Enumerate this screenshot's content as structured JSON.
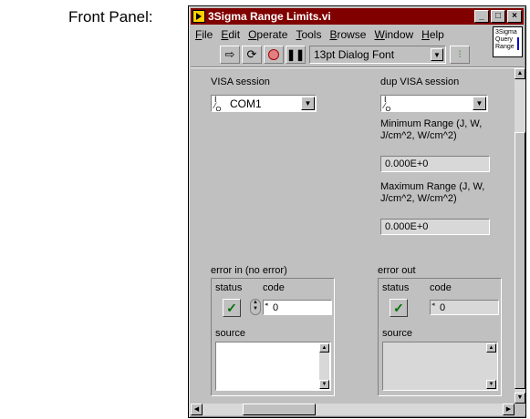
{
  "page": {
    "label": "Front Panel:"
  },
  "window": {
    "title": "3Sigma Range Limits.vi",
    "buttons": [
      "_",
      "□",
      "×"
    ],
    "menu": [
      {
        "label": "File",
        "key": "F",
        "rest": "ile"
      },
      {
        "label": "Edit",
        "key": "E",
        "rest": "dit"
      },
      {
        "label": "Operate",
        "key": "O",
        "rest": "perate"
      },
      {
        "label": "Tools",
        "key": "T",
        "rest": "ools"
      },
      {
        "label": "Browse",
        "key": "B",
        "rest": "rowse"
      },
      {
        "label": "Window",
        "key": "W",
        "rest": "indow"
      },
      {
        "label": "Help",
        "key": "H",
        "rest": "elp"
      }
    ],
    "vi_icon_text": "3Sigma Query Range",
    "toolbar": {
      "font": "13pt Dialog Font",
      "icons": [
        "run-arrow-icon",
        "run-continuous-icon",
        "abort-icon",
        "pause-icon",
        "align-icon"
      ]
    }
  },
  "panel": {
    "visa_session": {
      "label": "VISA session",
      "value": "COM1",
      "io_prefix": "I/O"
    },
    "dup_visa_session": {
      "label": "dup VISA session",
      "value": "",
      "io_prefix": "I/O"
    },
    "min_range": {
      "label": "Minimum Range (J, W, J/cm^2, W/cm^2)",
      "value": "0.000E+0"
    },
    "max_range": {
      "label": "Maximum Range (J, W, J/cm^2, W/cm^2)",
      "value": "0.000E+0"
    },
    "error_in": {
      "label": "error in (no error)",
      "status_label": "status",
      "code_label": "code",
      "code_value": "0",
      "source_label": "source",
      "status_ok": true,
      "status_glyph": "✓"
    },
    "error_out": {
      "label": "error out",
      "status_label": "status",
      "code_label": "code",
      "code_value": "0",
      "source_label": "source",
      "status_ok": true,
      "status_glyph": "✓"
    }
  }
}
